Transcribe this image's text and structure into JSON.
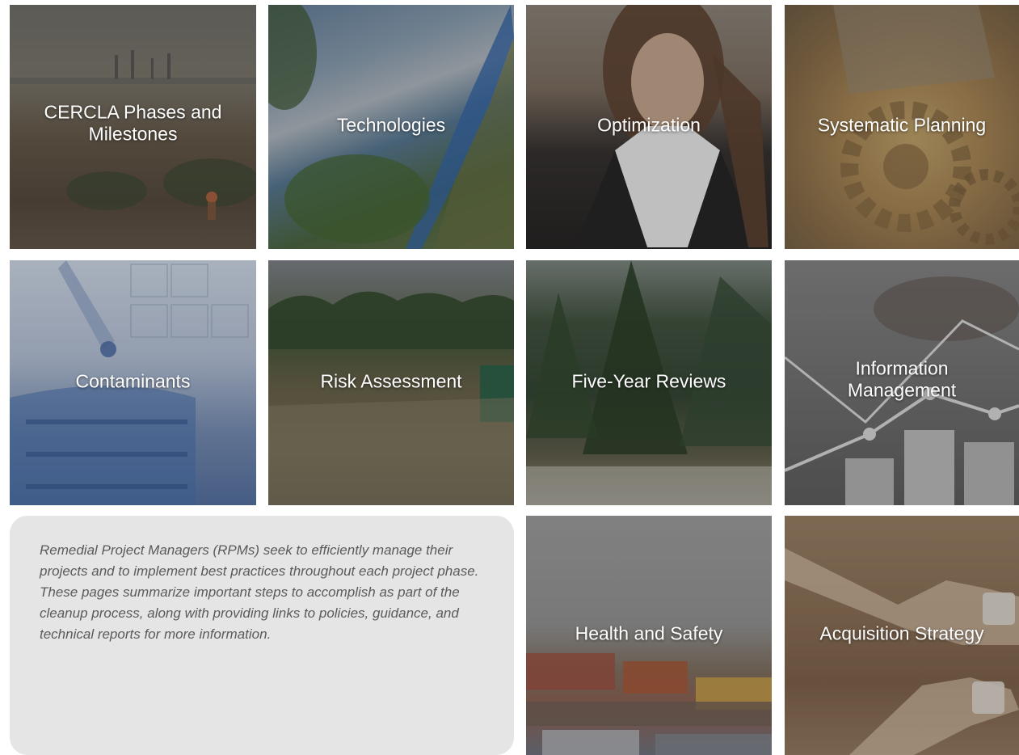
{
  "tiles": [
    {
      "label": "CERCLA Phases and\nMilestones"
    },
    {
      "label": "Technologies"
    },
    {
      "label": "Optimization"
    },
    {
      "label": "Systematic Planning"
    },
    {
      "label": "Contaminants"
    },
    {
      "label": "Risk Assessment"
    },
    {
      "label": "Five-Year Reviews"
    },
    {
      "label": "Information\nManagement"
    },
    {
      "label": "Health and Safety"
    },
    {
      "label": "Acquisition Strategy"
    }
  ],
  "intro": {
    "text": "Remedial Project Managers (RPMs) seek to efficiently manage their projects and to implement best practices throughout each project phase. These pages summarize important steps to accomplish as part of the cleanup process, along with providing links to policies, guidance, and technical reports for more information."
  }
}
